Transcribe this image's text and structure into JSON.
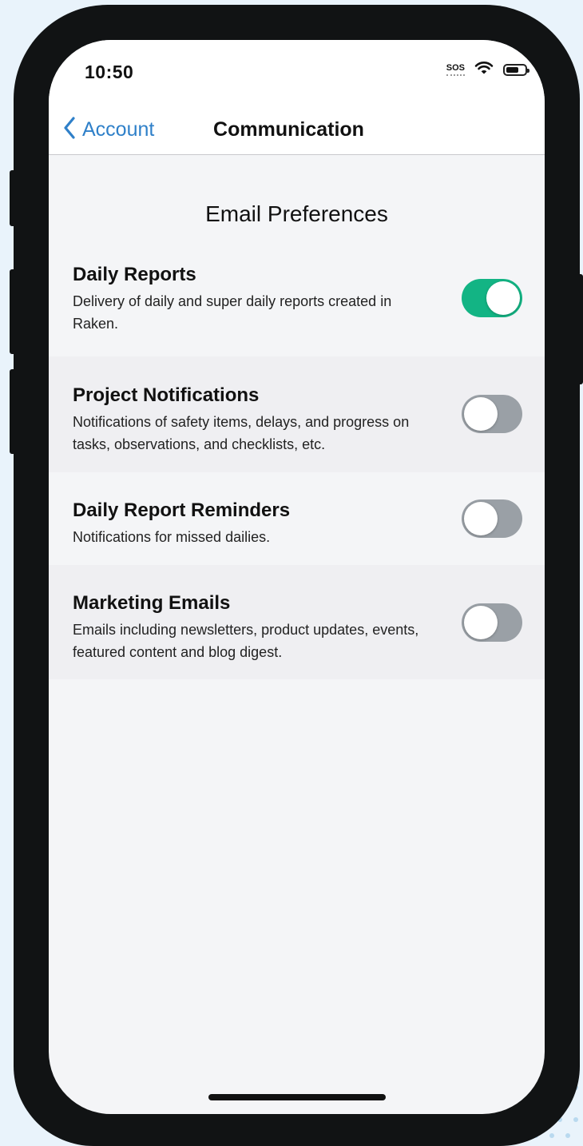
{
  "status_bar": {
    "time": "10:50",
    "sos": "SOS"
  },
  "nav": {
    "back_label": "Account",
    "title": "Communication"
  },
  "section_title": "Email Preferences",
  "preferences": [
    {
      "title": "Daily Reports",
      "description": "Delivery of daily and super daily reports created in Raken.",
      "enabled": true
    },
    {
      "title": "Project Notifications",
      "description": "Notifications of safety items, delays, and progress on tasks, observations, and checklists, etc.",
      "enabled": false
    },
    {
      "title": "Daily Report Reminders",
      "description": "Notifications for missed dailies.",
      "enabled": false
    },
    {
      "title": "Marketing Emails",
      "description": "Emails including newsletters, product updates, events, featured content and blog digest.",
      "enabled": false
    }
  ],
  "colors": {
    "accent": "#2f80c9",
    "toggle_on": "#13b484",
    "toggle_off": "#9aa0a6",
    "frame": "#111314",
    "background": "#e9f3fb"
  },
  "icons": {
    "back": "chevron-left-icon",
    "wifi": "wifi-icon",
    "battery": "battery-icon"
  }
}
